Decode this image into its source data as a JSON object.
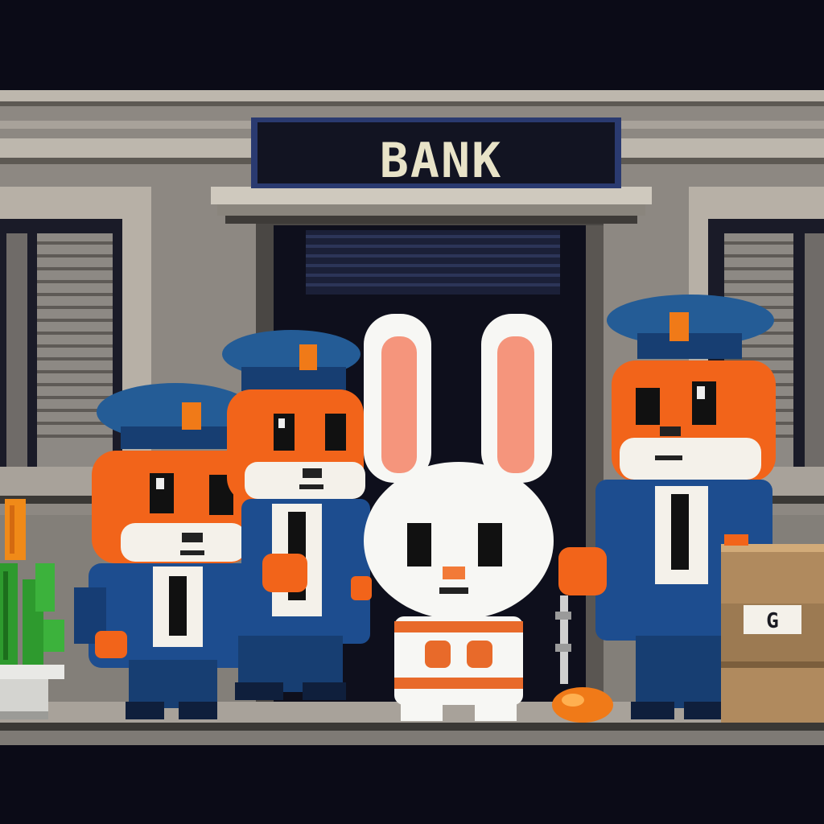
{
  "sign": {
    "text": "BANK"
  },
  "crate": {
    "label": "G"
  },
  "colors": {
    "sky": "#0b0b17",
    "wall": "#8d8882",
    "wall_dark": "#6e6a65",
    "trim": "#bdb7ad",
    "door": "#0e0f1c",
    "sign_bg": "#121422",
    "sign_border": "#2a3a70",
    "fox_orange": "#f2641a",
    "uniform_blue": "#1d4d8f",
    "cap_blue": "#245c96",
    "badge_orange": "#f07a18",
    "bunny_white": "#f7f7f4",
    "bunny_ear_pink": "#f5957c",
    "cactus_green": "#2e9a2e",
    "crate_brown": "#b08a5e"
  },
  "characters": [
    {
      "name": "fox-officer-left",
      "role": "officer"
    },
    {
      "name": "fox-officer-middle",
      "role": "officer"
    },
    {
      "name": "bunny-prisoner",
      "role": "prisoner"
    },
    {
      "name": "fox-officer-right",
      "role": "officer"
    }
  ]
}
